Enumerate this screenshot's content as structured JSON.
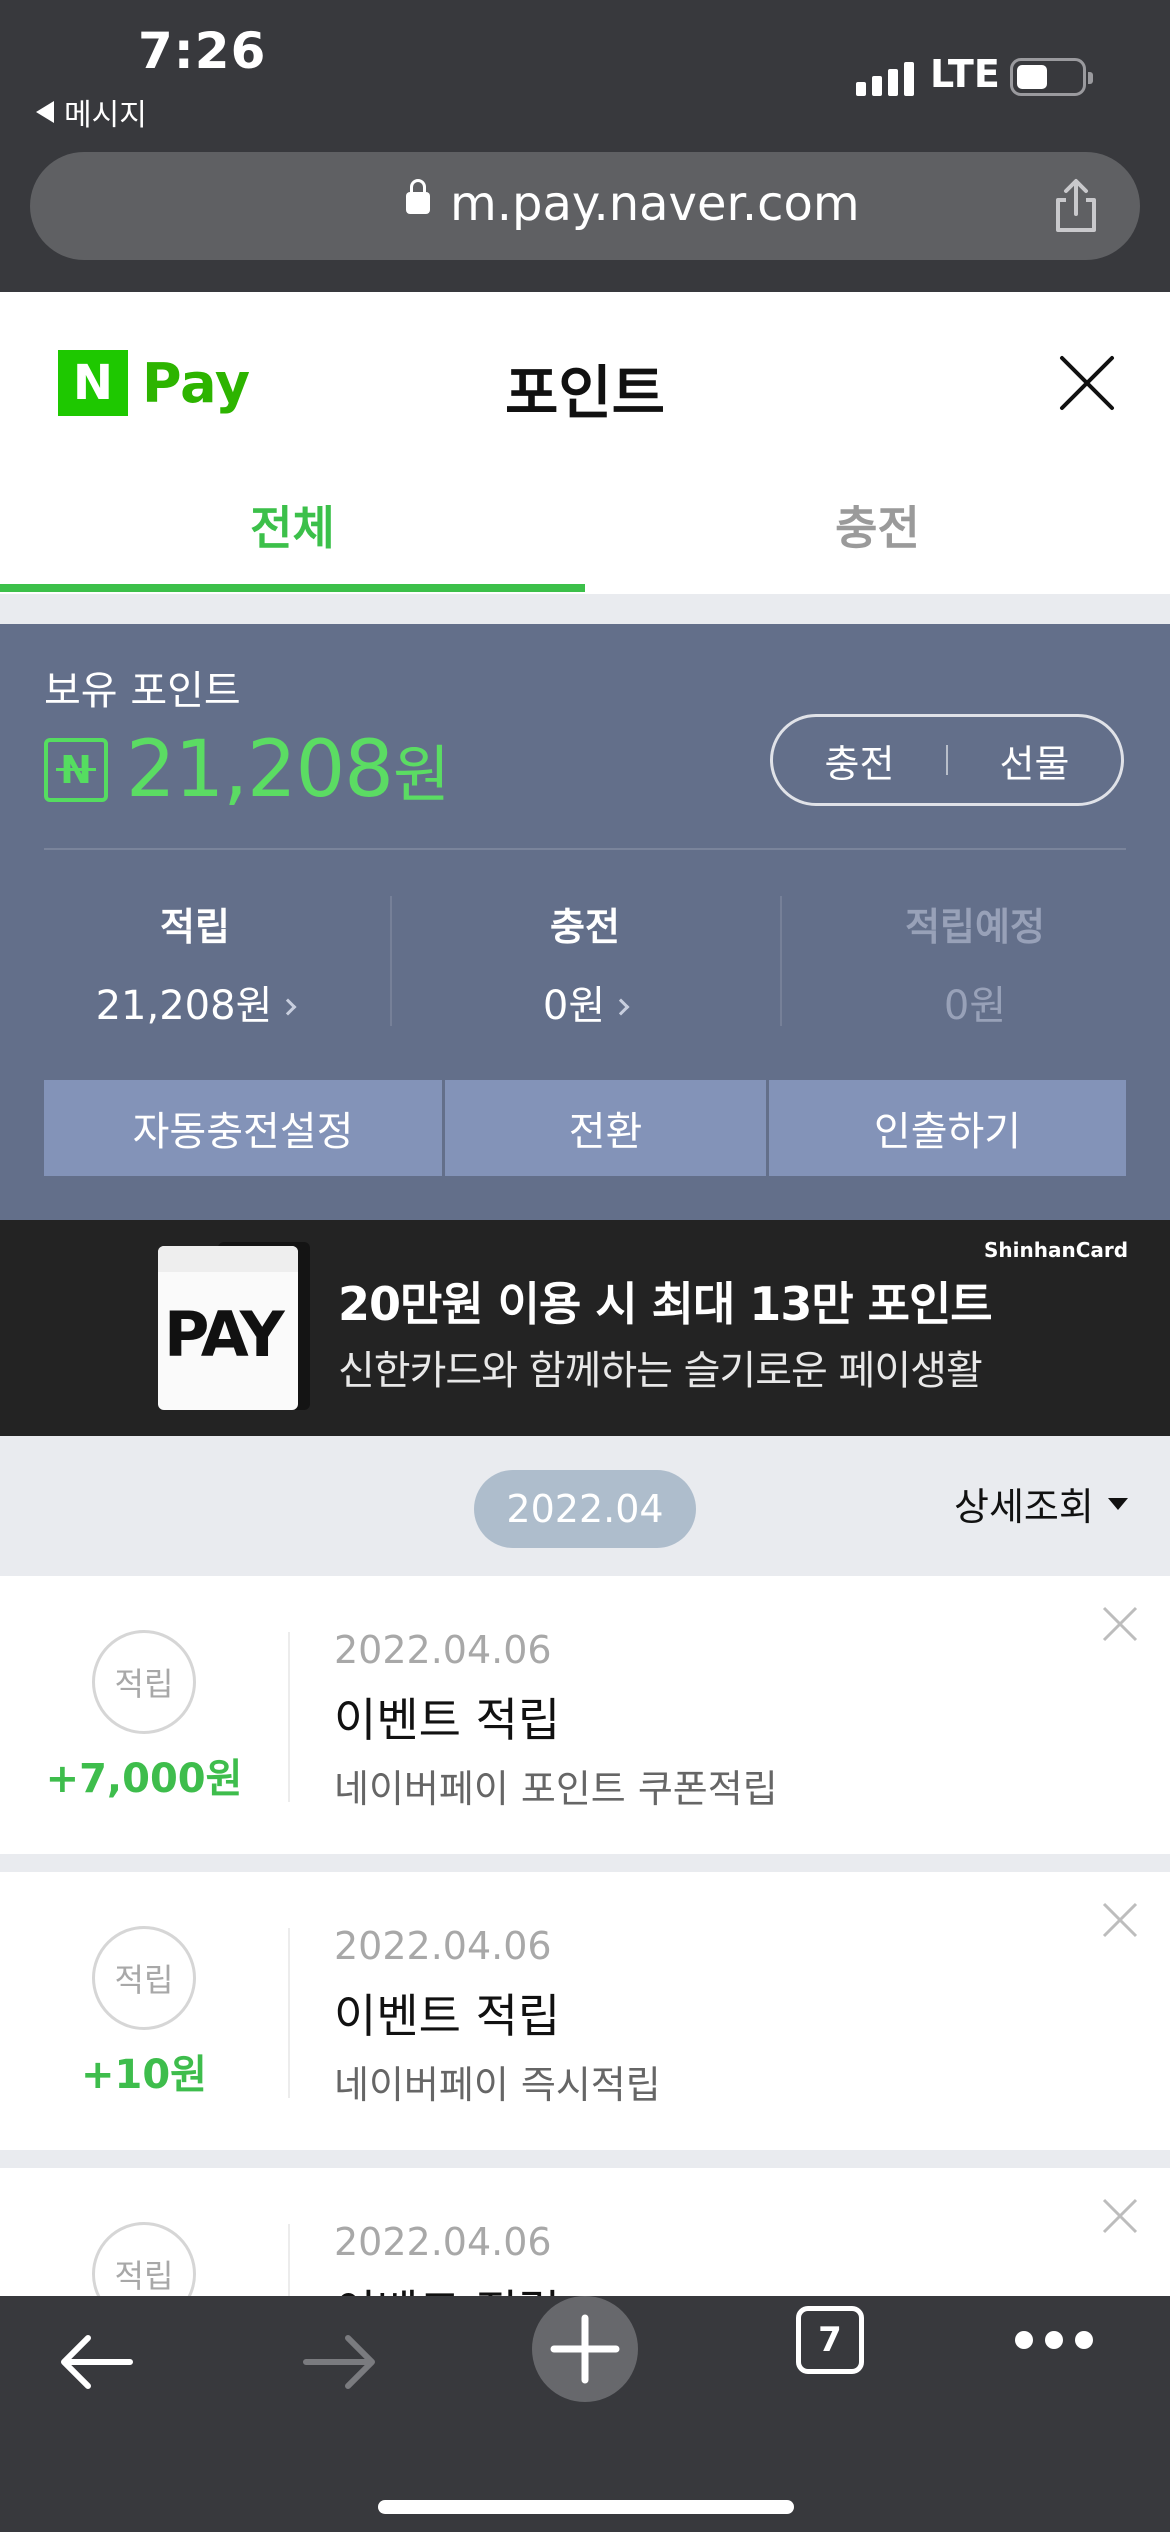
{
  "status_bar": {
    "time": "7:26",
    "back_app": "메시지",
    "network": "LTE"
  },
  "browser": {
    "url": "m.pay.naver.com",
    "icons": [
      "lock-icon",
      "share-icon"
    ]
  },
  "header": {
    "logo_n": "N",
    "logo_pay": "Pay",
    "title": "포인트",
    "close_icon": "close-icon"
  },
  "tabs": [
    {
      "label": "전체",
      "active": true
    },
    {
      "label": "충전",
      "active": false
    }
  ],
  "points": {
    "label": "보유 포인트",
    "coin_letter": "N",
    "amount": "21,208",
    "unit": "원",
    "actions": [
      "충전",
      "선물"
    ],
    "stats": [
      {
        "title": "적립",
        "value": "21,208원",
        "has_chevron": true
      },
      {
        "title": "충전",
        "value": "0원",
        "has_chevron": true
      },
      {
        "title": "적립예정",
        "value": "0원",
        "has_chevron": false
      }
    ],
    "buttons": [
      "자동충전설정",
      "전환",
      "인출하기"
    ]
  },
  "banner": {
    "brand": "ShinhanCard",
    "card_text": "PAY",
    "title": "20만원 이용 시 최대 13만 포인트",
    "subtitle": "신한카드와 함께하는 슬기로운 페이생활"
  },
  "history": {
    "month": "2022.04",
    "filter_label": "상세조회",
    "items": [
      {
        "badge": "적립",
        "delta": "+7,000원",
        "date": "2022.04.06",
        "title": "이벤트 적립",
        "desc": "네이버페이 포인트 쿠폰적립"
      },
      {
        "badge": "적립",
        "delta": "+10원",
        "date": "2022.04.06",
        "title": "이벤트 적립",
        "desc": "네이버페이 즉시적립"
      },
      {
        "badge": "적립",
        "delta": "",
        "date": "2022.04.06",
        "title": "이벤트 적립",
        "desc": ""
      }
    ]
  },
  "toolbar": {
    "tab_count": "7",
    "icons": [
      "back-arrow-icon",
      "forward-arrow-icon",
      "new-tab-icon",
      "tabs-icon",
      "more-icon"
    ]
  },
  "colors": {
    "brand_green": "#1ec800",
    "accent_green": "#3cc04a",
    "card_bg": "#636f8a",
    "card_button": "#8393b8"
  }
}
